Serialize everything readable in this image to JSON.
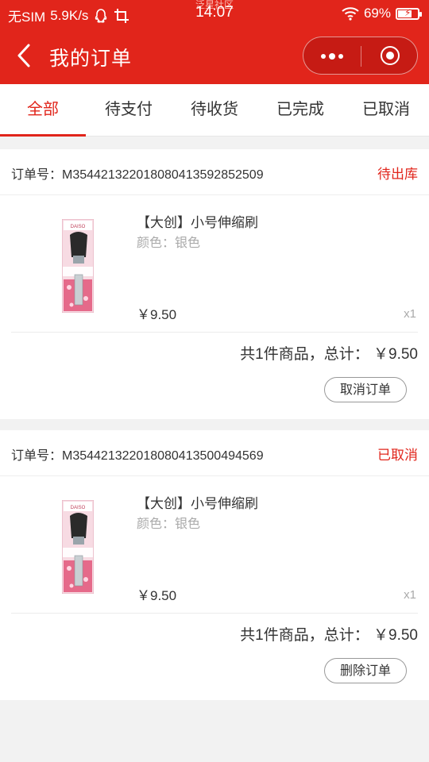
{
  "status_bar": {
    "carrier": "无SIM",
    "speed": "5.9K/s",
    "time": "14:07",
    "watermark": "泛星社区",
    "battery": "69%",
    "battery_level": 0.69
  },
  "navbar": {
    "title": "我的订单"
  },
  "tabs": [
    {
      "label": "全部",
      "active": true
    },
    {
      "label": "待支付",
      "active": false
    },
    {
      "label": "待收货",
      "active": false
    },
    {
      "label": "已完成",
      "active": false
    },
    {
      "label": "已取消",
      "active": false
    }
  ],
  "orders": [
    {
      "order_no": "订单号：M354421322018080413592852509",
      "status": "待出库",
      "product_name": "【大创】小号伸缩刷",
      "product_spec": "颜色：银色",
      "price": "￥9.50",
      "quantity": "x1",
      "summary": "共1件商品，总计： ￥9.50",
      "action": "取消订单"
    },
    {
      "order_no": "订单号：M354421322018080413500494569",
      "status": "已取消",
      "product_name": "【大创】小号伸缩刷",
      "product_spec": "颜色：银色",
      "price": "￥9.50",
      "quantity": "x1",
      "summary": "共1件商品，总计： ￥9.50",
      "action": "删除订单"
    }
  ],
  "colors": {
    "brand_red": "#e1251b",
    "background": "#f2f2f2"
  }
}
